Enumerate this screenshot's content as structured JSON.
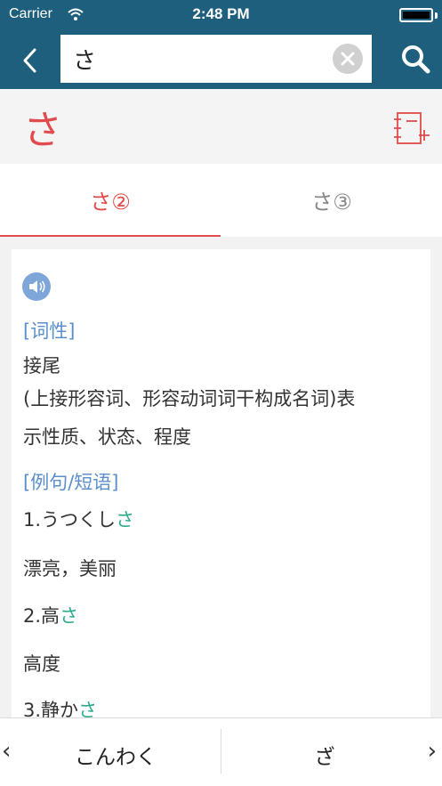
{
  "status": {
    "carrier": "Carrier",
    "time": "2:48 PM"
  },
  "search": {
    "value": "さ"
  },
  "entry": {
    "headword": "さ"
  },
  "tabs": [
    {
      "label": "さ②"
    },
    {
      "label": "さ③"
    }
  ],
  "definition": {
    "pos_heading": "[词性]",
    "pos_value": "接尾",
    "meaning_line1": "(上接形容词、形容动词词干构成名词)表",
    "meaning_line2": "示性质、状态、程度",
    "examples_heading": "[例句/短语]",
    "examples": [
      {
        "num": "1.",
        "prefix": "うつくし",
        "highlight": "さ",
        "translation": "漂亮，美丽"
      },
      {
        "num": "2.",
        "prefix": "高",
        "highlight": "さ",
        "translation": "高度"
      },
      {
        "num": "3.",
        "prefix": "静か",
        "highlight": "さ"
      }
    ]
  },
  "bottom_nav": {
    "prev_word": "こんわく",
    "next_word": "ざ"
  },
  "colors": {
    "nav_bar": "#1e5f7e",
    "accent_red": "#e14b4b",
    "section_blue": "#5b8fcb",
    "highlight_green": "#2aaa8a"
  }
}
